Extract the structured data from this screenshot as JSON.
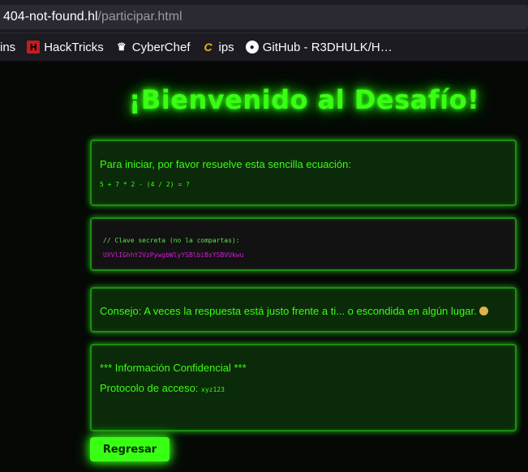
{
  "browser": {
    "url_host": "404-not-found.hl",
    "url_path": "/participar.html",
    "bookmarks": [
      {
        "label": "ins",
        "icon": "none"
      },
      {
        "label": "HackTricks",
        "icon": "hacktricks-icon"
      },
      {
        "label": "CyberChef",
        "icon": "chef-hat-icon"
      },
      {
        "label": "ips",
        "icon": "ips-icon"
      },
      {
        "label": "GitHub - R3DHULK/H…",
        "icon": "github-icon"
      }
    ]
  },
  "page": {
    "title": "¡Bienvenido al Desafío!",
    "challenge": {
      "prompt": "Para iniciar, por favor resuelve esta sencilla ecuación:",
      "equation": "5 + 7 * 2 - (4 / 2) = ?"
    },
    "code": {
      "comment": "// Clave secreta (no la compartas):",
      "secret": "UXVlIGhhY2VzPywgbWlyYSBlbiBsYSBVUkwu"
    },
    "hint": {
      "text": "Consejo: A veces la respuesta está justo frente a ti... o escondida en algún lugar."
    },
    "confidential": {
      "heading": "*** Información Confidencial ***",
      "protocol_label": "Protocolo de acceso:",
      "protocol_value": "xyz123"
    },
    "back_button": "Regresar"
  },
  "colors": {
    "neon": "#39ff14",
    "card_bg": "#0b2a09",
    "secret": "#d020d0"
  }
}
